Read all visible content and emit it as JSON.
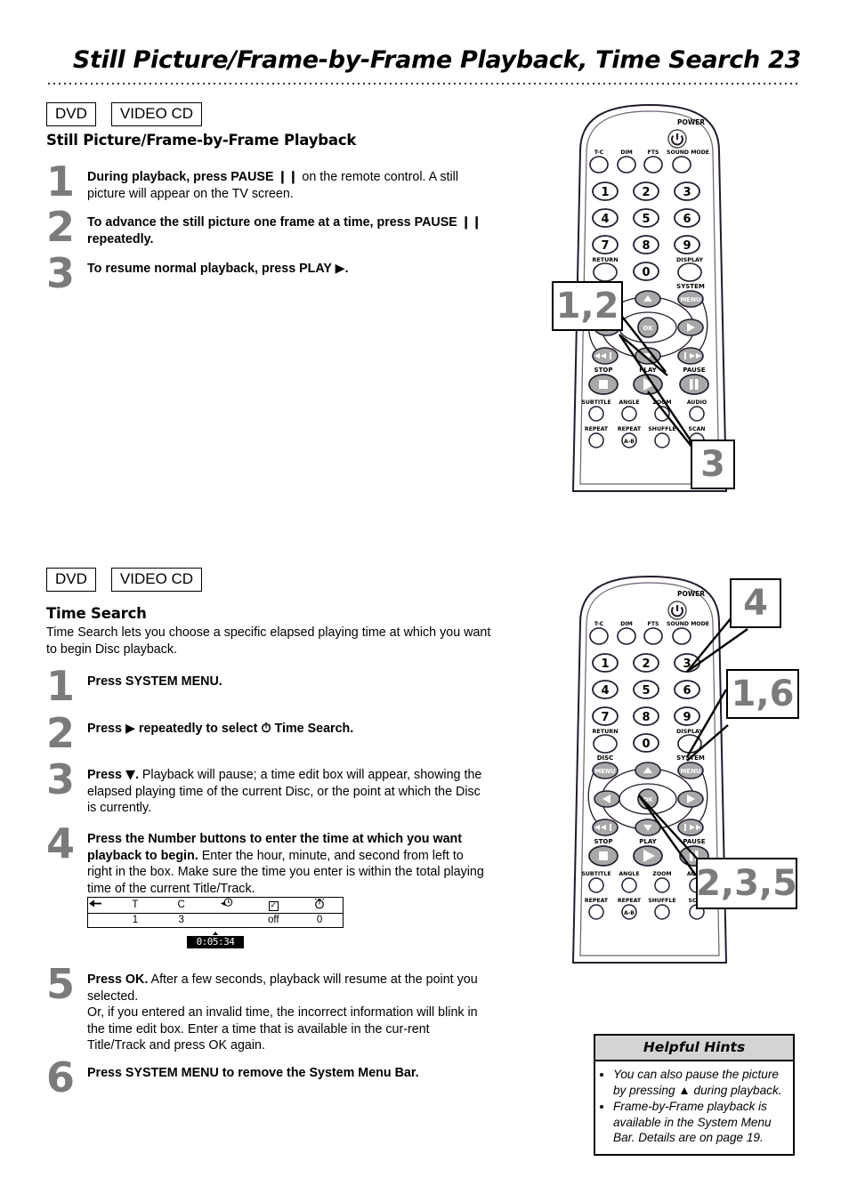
{
  "header": {
    "title": "Still Picture/Frame-by-Frame Playback, Time Search  23"
  },
  "section1": {
    "tags": [
      "DVD",
      "VIDEO CD"
    ],
    "heading": "Still Picture/Frame-by-Frame Playback",
    "steps": [
      {
        "num": "1",
        "html": "<b>During playback, press PAUSE <span class='glyph'>❙❙</span></b> on the remote control. A still picture will appear on the TV screen."
      },
      {
        "num": "2",
        "html": "<b>To advance the still picture one frame at a time, press PAUSE <span class='glyph'>❙❙</span> repeatedly.</b>"
      },
      {
        "num": "3",
        "html": "<b>To resume normal playback, press PLAY <span class='glyph'>▶</span>.</b>"
      }
    ],
    "callouts": [
      "1,2",
      "3"
    ]
  },
  "section2": {
    "tags": [
      "DVD",
      "VIDEO CD"
    ],
    "heading": "Time Search",
    "intro": "Time Search lets you choose a specific elapsed playing time at which you want to begin Disc playback.",
    "steps": [
      {
        "num": "1",
        "html": "<b>Press SYSTEM MENU.</b>"
      },
      {
        "num": "2",
        "html": "<b>Press <span class='glyph'>▶</span> repeatedly to select <span class='glyph'>⏱</span> Time Search.</b>"
      },
      {
        "num": "3",
        "html": "<b>Press <span class='glyph'>▼</span>.</b> Playback will pause; a time edit box will appear, showing the elapsed playing time of the current Disc, or the point at which the Disc is currently."
      },
      {
        "num": "4",
        "html": "<b>Press the Number buttons to enter the time at which you want playback to begin.</b> Enter the hour, minute, and second from left to right in the box. Make sure the time you enter is within the total playing time of the current Title/Track."
      },
      {
        "num": "5",
        "html": "<b>Press OK.</b> After a few seconds, playback will resume at the point you selected.<br>Or, if you entered an invalid time, the incorrect information will blink in the time edit box. Enter a time that is available in the cur-rent Title/Track and press OK again."
      },
      {
        "num": "6",
        "html": "<b>Press SYSTEM MENU to remove the System Menu Bar.</b>"
      }
    ],
    "callouts": [
      "4",
      "1,6",
      "2,3,5"
    ]
  },
  "menu_bar_figure": {
    "icons": [
      "T",
      "C",
      "time-search-icon",
      "checkmark-icon",
      "timer-icon"
    ],
    "labels_row": [
      "T",
      "C",
      "",
      "",
      ""
    ],
    "values_row": [
      "1",
      "3",
      "",
      "off",
      "0"
    ],
    "time_edit_box": "0:05:34"
  },
  "hints": {
    "title": "Helpful Hints",
    "items": [
      "You can also pause the picture by pressing ▲ during playback.",
      "Frame-by-Frame playback is available in the System Menu Bar. Details are on page 19."
    ]
  },
  "remote": {
    "power_label": "POWER",
    "top_buttons": [
      "T-C",
      "DIM",
      "FTS",
      "SOUND MODE"
    ],
    "number_keys": [
      "1",
      "2",
      "3",
      "4",
      "5",
      "6",
      "7",
      "8",
      "9",
      "0"
    ],
    "return_label": "RETURN",
    "display_label": "DISPLAY",
    "disc_menu_label": "DISC",
    "system_menu_label": "SYSTEM",
    "menu_btn_label": "MENU",
    "ok_label": "OK",
    "transport_labels": [
      "STOP",
      "PLAY",
      "PAUSE"
    ],
    "feature_row1": [
      "SUBTITLE",
      "ANGLE",
      "ZOOM",
      "AUDIO"
    ],
    "feature_row2": [
      "REPEAT",
      "REPEAT",
      "SHUFFLE",
      "SCAN"
    ],
    "repeat_ab_label": "A-B"
  },
  "colors": {
    "number_gray": "#7b7b7b",
    "button_gray": "#a8a8a8",
    "hint_header": "#d4d4d4"
  }
}
